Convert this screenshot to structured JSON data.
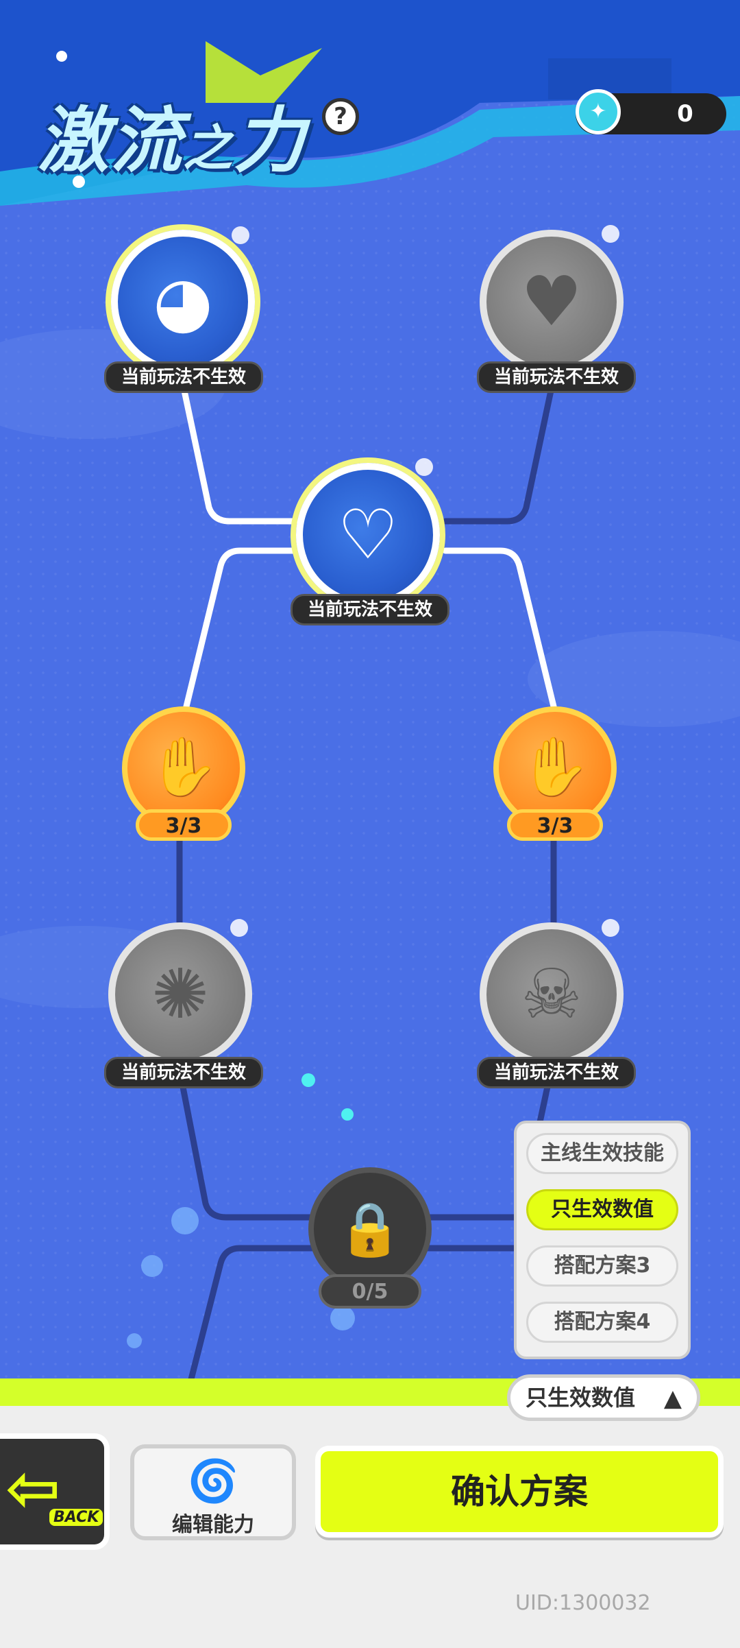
{
  "header": {
    "title_main": "激流",
    "title_small": "之",
    "title_tail": "力",
    "help_label": "?",
    "currency": {
      "icon": "water-drop-icon",
      "value": "0"
    }
  },
  "nodes": {
    "top_left": {
      "label": "当前玩法不生效",
      "icon": "octopus-swimmer-icon",
      "state": "active"
    },
    "top_right": {
      "label": "当前玩法不生效",
      "icon": "heart-up-icon",
      "state": "inactive"
    },
    "middle": {
      "label": "当前玩法不生效",
      "icon": "heart-plus-icon",
      "state": "active"
    },
    "orange_left": {
      "progress": "3/3",
      "icon": "handshake-up-icon"
    },
    "orange_right": {
      "progress": "3/3",
      "icon": "handshake-up-icon"
    },
    "lower_left": {
      "label": "当前玩法不生效",
      "icon": "swirl-icon",
      "state": "inactive"
    },
    "lower_right": {
      "label": "当前玩法不生效",
      "icon": "skull-icon",
      "state": "inactive"
    },
    "locked": {
      "progress": "0/5",
      "icon": "lock-icon"
    }
  },
  "dropdown": {
    "options": [
      "主线生效技能",
      "只生效数值",
      "搭配方案3",
      "搭配方案4"
    ],
    "selected": "只生效数值",
    "toggle_label": "只生效数值"
  },
  "bottom": {
    "back_label": "BACK",
    "edit_label": "编辑能力",
    "confirm_label": "确认方案",
    "uid": "UID:1300032"
  },
  "colors": {
    "background": "#4a6fe6",
    "accent_lime": "#e4ff14",
    "orange": "#ff8a1f"
  }
}
